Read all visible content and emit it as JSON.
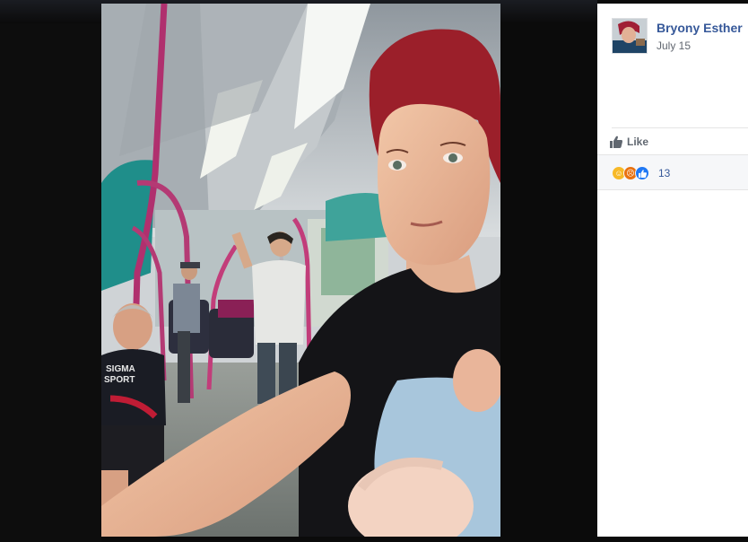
{
  "post": {
    "author": "Bryony Esther",
    "date": "July 15"
  },
  "actions": {
    "like_label": "Like"
  },
  "reactions": {
    "icons": [
      "haha-icon",
      "angry-icon",
      "like-icon"
    ],
    "count": "13"
  },
  "colors": {
    "author_link": "#365899",
    "meta_text": "#616770",
    "panel_bg": "#ffffff",
    "reactions_bg": "#f6f7f9",
    "lightbox_bg": "#0b0b0b"
  }
}
